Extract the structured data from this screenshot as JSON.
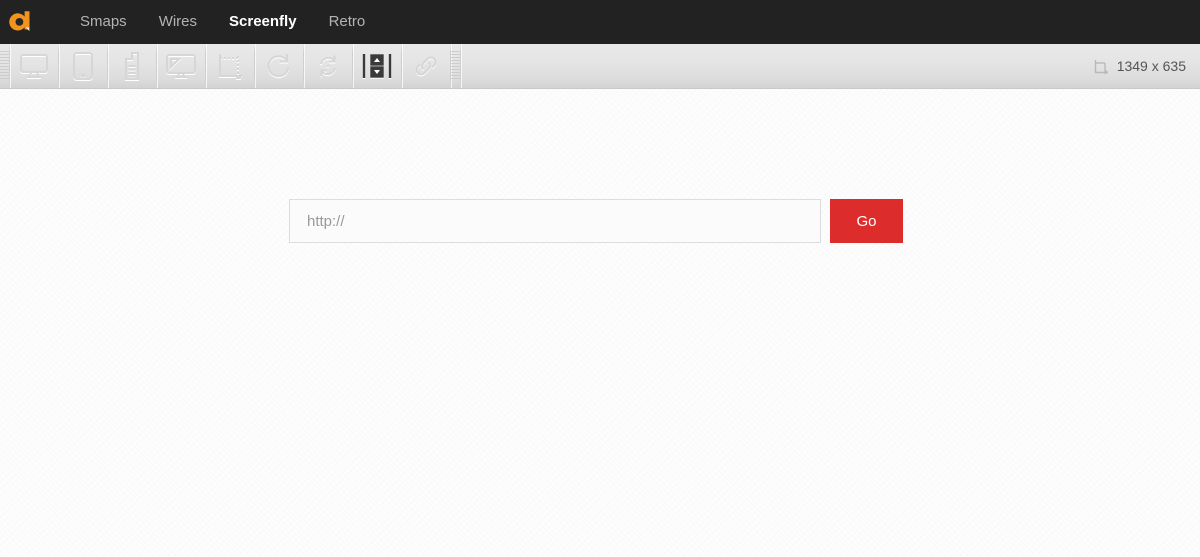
{
  "nav": {
    "logo_icon": "quirktools-a-logo",
    "items": [
      {
        "label": "Smaps",
        "active": false
      },
      {
        "label": "Wires",
        "active": false
      },
      {
        "label": "Screenfly",
        "active": true
      },
      {
        "label": "Retro",
        "active": false
      }
    ]
  },
  "toolbar": {
    "buttons": [
      {
        "icon": "desktop-monitor-icon",
        "active": false
      },
      {
        "icon": "tablet-icon",
        "active": false
      },
      {
        "icon": "mobile-phone-icon",
        "active": false
      },
      {
        "icon": "television-icon",
        "active": false
      },
      {
        "icon": "custom-screen-size-icon",
        "active": false
      },
      {
        "icon": "refresh-icon",
        "active": false
      },
      {
        "icon": "auto-refresh-icon",
        "active": false
      },
      {
        "icon": "toggle-scrollbars-icon",
        "active": true
      },
      {
        "icon": "share-link-icon",
        "active": false
      }
    ],
    "size_readout": {
      "icon": "screen-dimensions-icon",
      "text": "1349 x 635",
      "width": "1349",
      "height": "635"
    }
  },
  "main": {
    "url_field": {
      "value": "",
      "placeholder": "http://"
    },
    "go_label": "Go"
  },
  "colors": {
    "nav_background": "#222222",
    "logo_orange": "#f0931f",
    "toolbar_top": "#e9e9e9",
    "toolbar_bottom": "#d3d3d3",
    "go_red": "#dd2c2c",
    "active_icon": "#3a3a3a",
    "inactive_icon": "#d6d6d6"
  }
}
